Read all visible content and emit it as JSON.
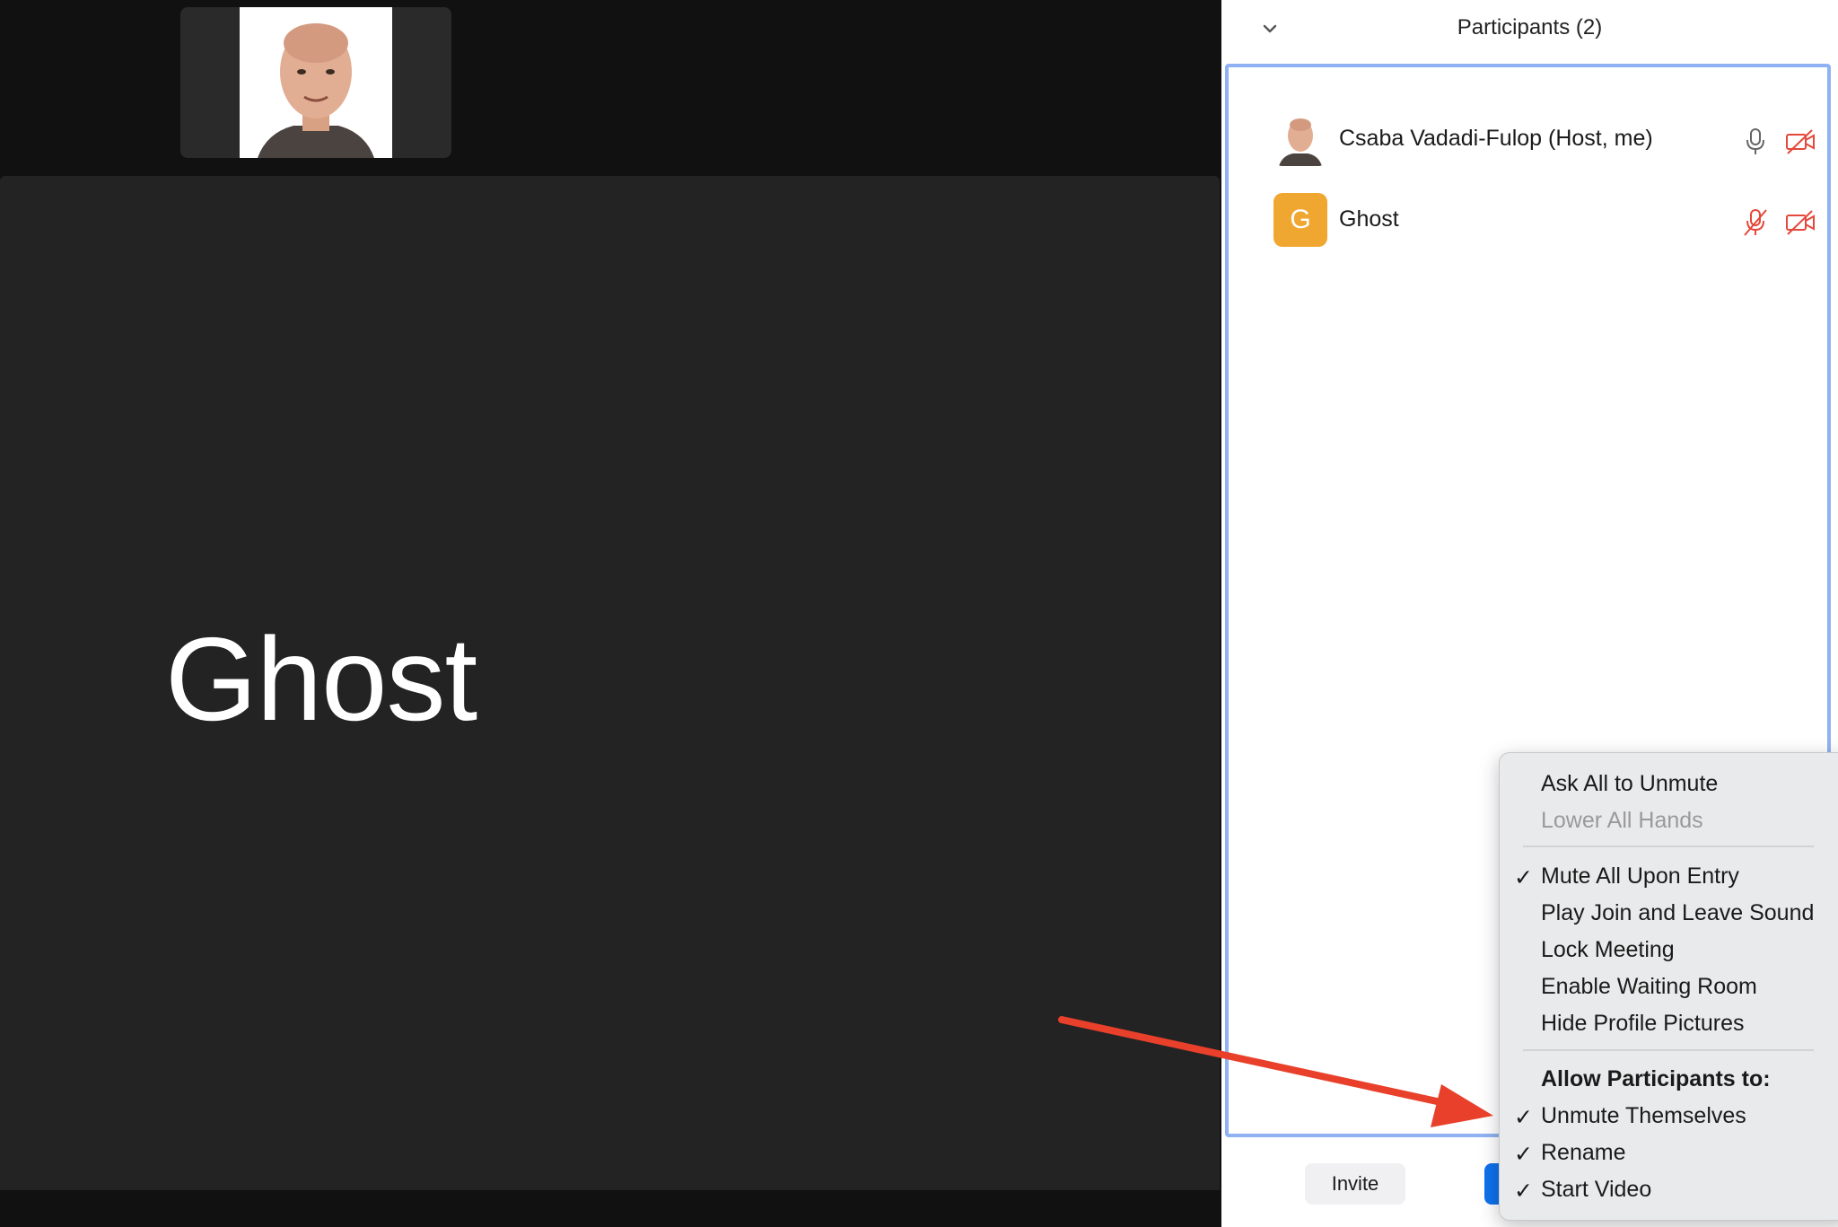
{
  "video": {
    "speaker_name": "Ghost"
  },
  "panel": {
    "title": "Participants (2)",
    "participants": [
      {
        "name": "Csaba Vadadi-Fulop (Host, me)",
        "audio": "on",
        "video": "off"
      },
      {
        "name": "Ghost",
        "avatar_letter": "G",
        "avatar_color": "#f0a732",
        "audio": "muted",
        "video": "off"
      }
    ],
    "invite_label": "Invite"
  },
  "menu": {
    "items_top": [
      {
        "label": "Ask All to Unmute",
        "checked": false,
        "enabled": true
      },
      {
        "label": "Lower All Hands",
        "checked": false,
        "enabled": false
      }
    ],
    "items_mid": [
      {
        "label": "Mute All Upon Entry",
        "checked": true
      },
      {
        "label": "Play Join and Leave Sound",
        "checked": false
      },
      {
        "label": "Lock Meeting",
        "checked": false
      },
      {
        "label": "Enable Waiting Room",
        "checked": false
      },
      {
        "label": "Hide Profile Pictures",
        "checked": false
      }
    ],
    "section_header": "Allow Participants to:",
    "items_allow": [
      {
        "label": "Unmute Themselves",
        "checked": true
      },
      {
        "label": "Rename",
        "checked": true
      },
      {
        "label": "Start Video",
        "checked": true
      }
    ],
    "check_glyph": "✓"
  },
  "colors": {
    "accent_blue": "#0e72ed",
    "panel_border": "#8fb3f2",
    "alert_red": "#e5483b",
    "arrow_red": "#e8402a"
  }
}
